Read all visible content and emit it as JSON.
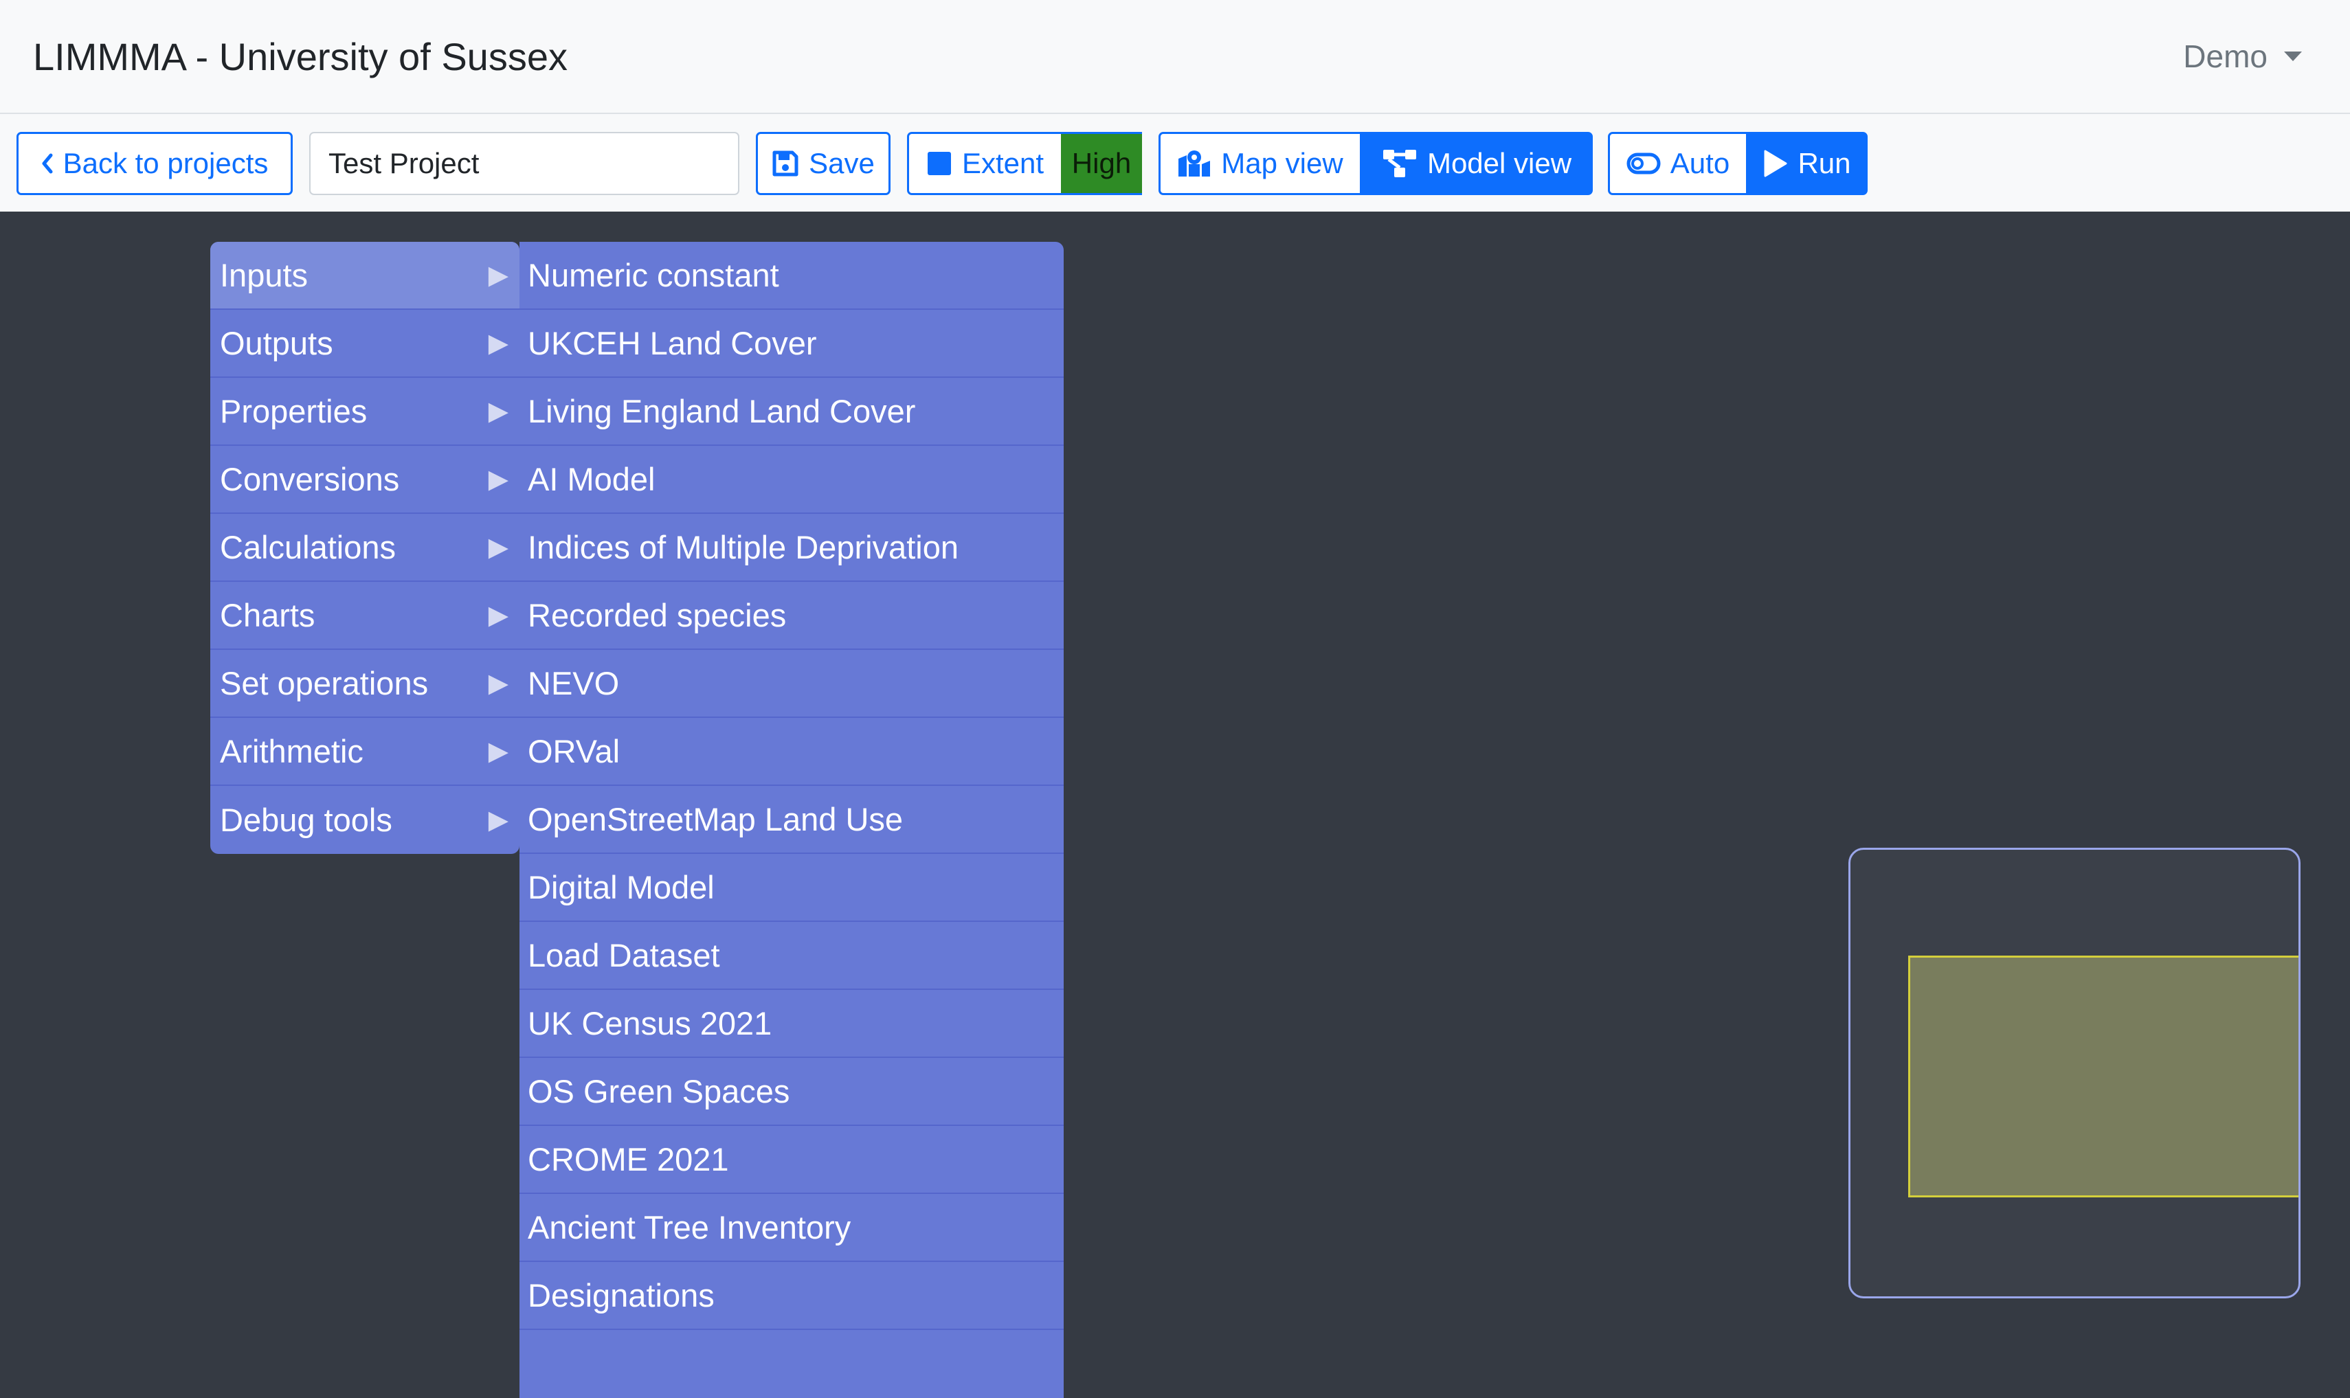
{
  "header": {
    "title": "LIMMMA - University of Sussex",
    "user_menu": "Demo"
  },
  "toolbar": {
    "back_label": "Back to projects",
    "project_name": "Test Project",
    "save_label": "Save",
    "extent_label": "Extent",
    "quality_label": "High",
    "map_view_label": "Map view",
    "model_view_label": "Model view",
    "auto_label": "Auto",
    "run_label": "Run"
  },
  "context_menu": {
    "items": [
      {
        "label": "Inputs",
        "arrow": "▶"
      },
      {
        "label": "Outputs",
        "arrow": "▶"
      },
      {
        "label": "Properties",
        "arrow": "▶"
      },
      {
        "label": "Conversions",
        "arrow": "▶"
      },
      {
        "label": "Calculations",
        "arrow": "▶"
      },
      {
        "label": "Charts",
        "arrow": "▶"
      },
      {
        "label": "Set operations",
        "arrow": "▶"
      },
      {
        "label": "Arithmetic",
        "arrow": "▶"
      },
      {
        "label": "Debug tools",
        "arrow": "▶"
      }
    ],
    "submenu": [
      "Numeric constant",
      "UKCEH Land Cover",
      "Living England Land Cover",
      "AI Model",
      "Indices of Multiple Deprivation",
      "Recorded species",
      "NEVO",
      "ORVal",
      "OpenStreetMap Land Use",
      "Digital Model",
      "Load Dataset",
      "UK Census 2021",
      "OS Green Spaces",
      "CROME 2021",
      "Ancient Tree Inventory",
      "Designations"
    ]
  },
  "colors": {
    "primary": "#0d6efd",
    "menu_bg": "#6779d6",
    "canvas_bg": "#353a43",
    "quality_high": "#2e8b25"
  }
}
